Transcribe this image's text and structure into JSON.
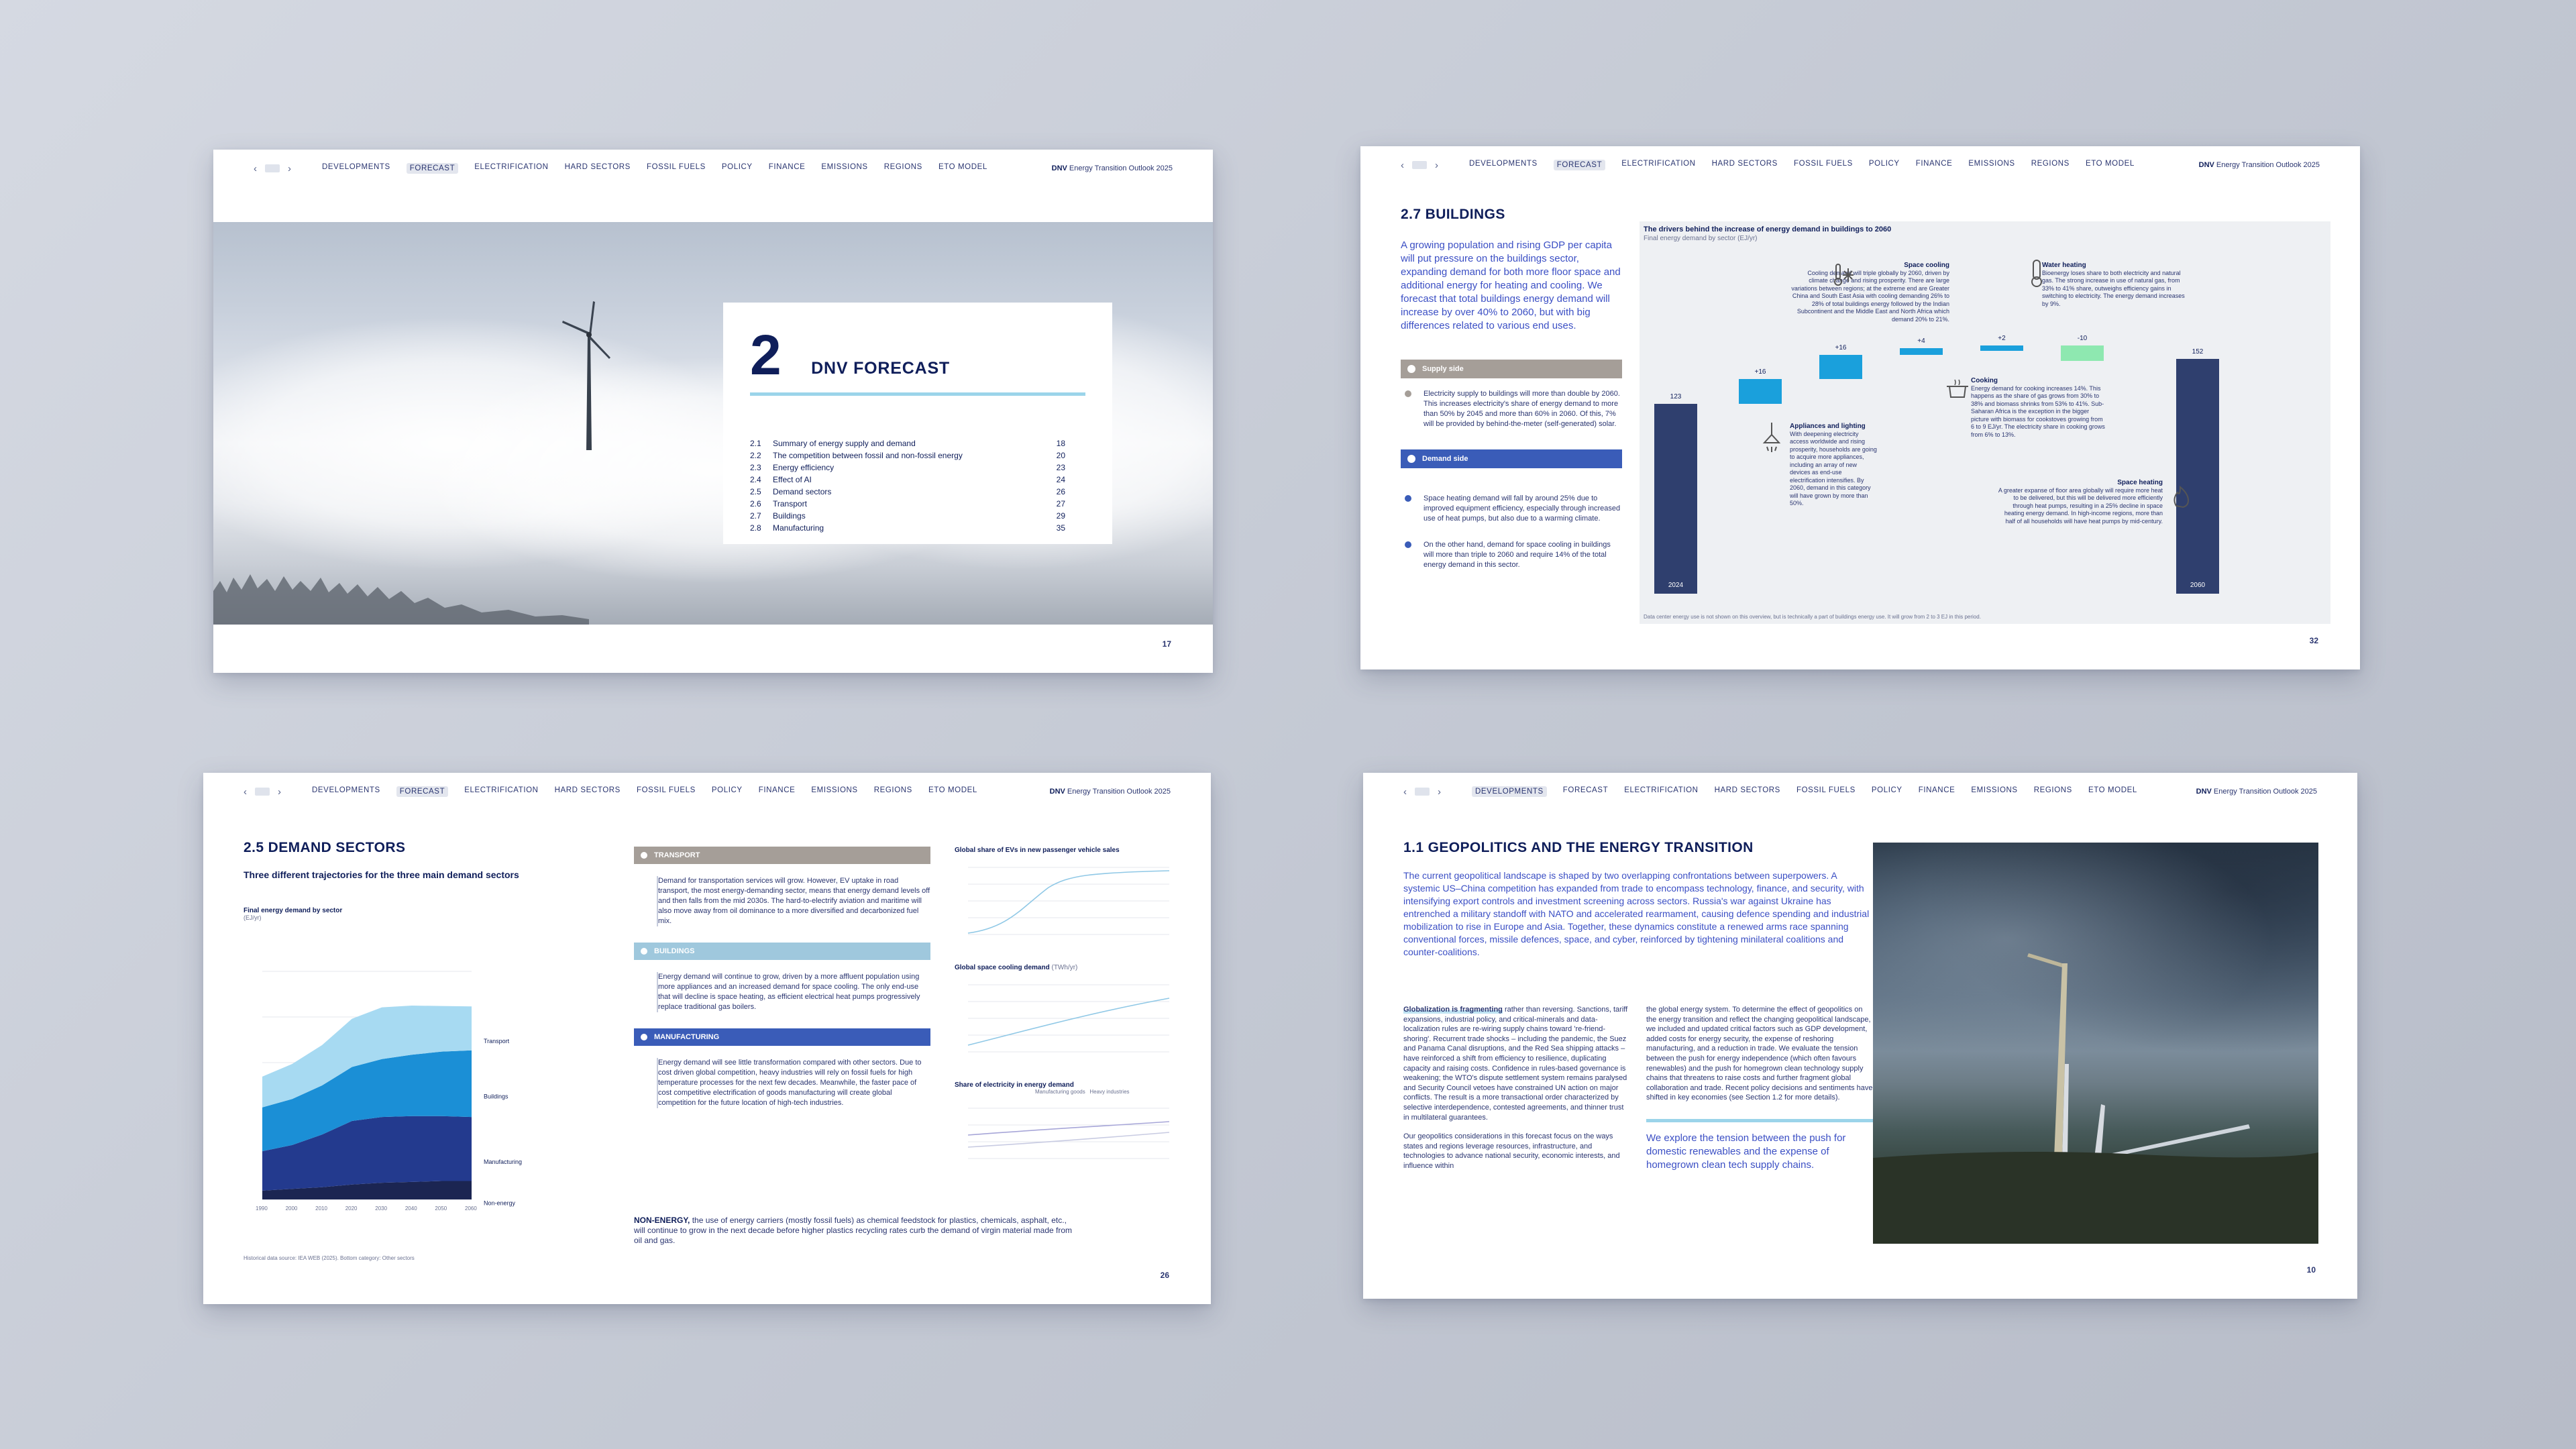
{
  "nav": {
    "items": [
      "DEVELOPMENTS",
      "FORECAST",
      "ELECTRIFICATION",
      "HARD SECTORS",
      "FOSSIL FUELS",
      "POLICY",
      "FINANCE",
      "EMISSIONS",
      "REGIONS",
      "ETO MODEL"
    ],
    "brand_bold": "DNV",
    "brand": "Energy Transition Outlook 2025"
  },
  "slide1": {
    "chapter_number": "2",
    "chapter_title": "DNV FORECAST",
    "toc": [
      {
        "n": "2.1",
        "t": "Summary of energy supply and demand",
        "p": "18"
      },
      {
        "n": "2.2",
        "t": "The competition between fossil and non-fossil energy",
        "p": "20"
      },
      {
        "n": "2.3",
        "t": "Energy efficiency",
        "p": "23"
      },
      {
        "n": "2.4",
        "t": "Effect of AI",
        "p": "24"
      },
      {
        "n": "2.5",
        "t": "Demand sectors",
        "p": "26"
      },
      {
        "n": "2.6",
        "t": "Transport",
        "p": "27"
      },
      {
        "n": "2.7",
        "t": "Buildings",
        "p": "29"
      },
      {
        "n": "2.8",
        "t": "Manufacturing",
        "p": "35"
      }
    ],
    "page": "17"
  },
  "slide2": {
    "heading": "2.7 BUILDINGS",
    "lead": "A growing population and rising GDP per capita will put pressure on the buildings sector, expanding demand for both more floor space and additional energy for heating and cooling. We forecast that total buildings energy demand will increase by over 40% to 2060, but with big differences related to various end uses.",
    "supply_label": "Supply side",
    "supply_text": "Electricity supply to buildings will more than double by 2060. This increases electricity's share of energy demand to more than 50% by 2045 and more than 60% in 2060. Of this, 7% will be provided by behind-the-meter (self-generated) solar.",
    "demand_label": "Demand side",
    "demand_text_1": "Space heating demand will fall by around 25% due to improved equipment efficiency, especially through increased use of heat pumps, but also due to a warming climate.",
    "demand_text_2": "On the other hand, demand for space cooling in buildings will more than triple to 2060 and require 14% of the total energy demand in this sector.",
    "chart_title": "The drivers behind the increase of energy demand in buildings to 2060",
    "chart_subtitle": "Final energy demand by sector (EJ/yr)",
    "notes": {
      "cooling_title": "Space cooling",
      "cooling_text": "Cooling demand will triple globally by 2060, driven by climate change and rising prosperity. There are large variations between regions; at the extreme end are Greater China and South East Asia with cooling demanding 26% to 28% of total buildings energy followed by the Indian Subcontinent and the Middle East and North Africa which demand 20% to 21%.",
      "water_title": "Water heating",
      "water_text": "Bioenergy loses share to both electricity and natural gas. The strong increase in use of natural gas, from 33% to 41% share, outweighs efficiency gains in switching to electricity. The energy demand increases by 9%.",
      "appliances_title": "Appliances and lighting",
      "appliances_text": "With deepening electricity access worldwide and rising prosperity, households are going to acquire more appliances, including an array of new devices as end-use electrification intensifies. By 2060, demand in this category will have grown by more than 50%.",
      "cooking_title": "Cooking",
      "cooking_text": "Energy demand for cooking increases 14%. This happens as the share of gas grows from 30% to 38% and biomass shrinks from 53% to 41%. Sub-Saharan Africa is the exception in the bigger picture with biomass for cookstoves growing from 6 to 9 EJ/yr. The electricity share in cooking grows from 6% to 13%.",
      "heating_title": "Space heating",
      "heating_text": "A greater expanse of floor area globally will require more heat to be delivered, but this will be delivered more efficiently through heat pumps, resulting in a 25% decline in space heating energy demand. In high-income regions, more than half of all households will have heat pumps by mid-century."
    },
    "footnote": "Data center energy use is not shown on this overview, but is technically a part of buildings energy use. It will grow from 2 to 3 EJ in this period.",
    "page": "32"
  },
  "slide3": {
    "heading": "2.5 DEMAND SECTORS",
    "subheading": "Three different trajectories for the three main demand sectors",
    "chart_title": "Final energy demand by sector",
    "chart_unit": "(EJ/yr)",
    "sector_labels": [
      "Transport",
      "Buildings",
      "Manufacturing",
      "Non-energy"
    ],
    "transport_label": "TRANSPORT",
    "transport_text": "Demand for transportation services will grow. However, EV uptake in road transport, the most energy-demanding sector, means that energy demand levels off and then falls from the mid 2030s. The hard-to-electrify aviation and maritime will also move away from oil dominance to a more diversified and decarbonized fuel mix.",
    "buildings_label": "BUILDINGS",
    "buildings_text": "Energy demand will continue to grow, driven by a more affluent population using more appliances and an increased demand for space cooling. The only end-use that will decline is space heating, as efficient electrical heat pumps progressively replace traditional gas boilers.",
    "manufacturing_label": "MANUFACTURING",
    "manufacturing_text": "Energy demand will see little transformation compared with other sectors. Due to cost driven global competition, heavy industries will rely on fossil fuels for high temperature processes for the next few decades. Meanwhile, the faster pace of cost competitive electrification of goods manufacturing will create global competition for the future location of high-tech industries.",
    "chart2_title": "Global share of EVs in new passenger vehicle sales",
    "chart3_title": "Global space cooling demand",
    "chart3_unit": "(TWh/yr)",
    "chart4_title": "Share of electricity in energy demand",
    "chart4_legend": [
      "Manufacturing goods",
      "Heavy industries"
    ],
    "non_energy_bold": "NON-ENERGY,",
    "non_energy_text": "the use of energy carriers (mostly fossil fuels) as chemical feedstock for plastics, chemicals, asphalt, etc., will continue to grow in the next decade before higher plastics recycling rates curb the demand of virgin material made from oil and gas.",
    "source": "Historical data source: IEA WEB (2025). Bottom category: Other sectors",
    "page": "26"
  },
  "slide4": {
    "heading": "1.1 GEOPOLITICS AND THE ENERGY TRANSITION",
    "lead": "The current geopolitical landscape is shaped by two overlapping confrontations between superpowers. A systemic US–China competition has expanded from trade to encompass technology, finance, and security, with intensifying export controls and investment screening across sectors. Russia's war against Ukraine has entrenched a military standoff with NATO and accelerated rearmament, causing defence spending and industrial mobilization to rise in Europe and Asia. Together, these dynamics constitute a renewed arms race spanning conventional forces, missile defences, space, and cyber, reinforced by tightening minilateral coalitions and counter-coalitions.",
    "col1_bold": "Globalization is fragmenting",
    "col1": "rather than reversing. Sanctions, tariff expansions, industrial policy, and critical-minerals and data-localization rules are re-wiring supply chains toward 're-friend-shoring'. Recurrent trade shocks – including the pandemic, the Suez and Panama Canal disruptions, and the Red Sea shipping attacks – have reinforced a shift from efficiency to resilience, duplicating capacity and raising costs. Confidence in rules-based governance is weakening; the WTO's dispute settlement system remains paralysed and Security Council vetoes have constrained UN action on major conflicts. The result is a more transactional order characterized by selective interdependence, contested agreements, and thinner trust in multilateral guarantees.",
    "col1_b": "Our geopolitics considerations in this forecast focus on the ways states and regions leverage resources, infrastructure, and technologies to advance national security, economic interests, and influence within",
    "col2": "the global energy system. To determine the effect of geopolitics on the energy transition and reflect the changing geopolitical landscape, we included and updated critical factors such as GDP development, added costs for energy security, the expense of reshoring manufacturing, and a reduction in trade. We evaluate the tension between the push for energy independence (which often favours renewables) and the push for homegrown clean technology supply chains that threatens to raise costs and further fragment global collaboration and trade. Recent policy decisions and sentiments have shifted in key economies (see Section 1.2 for more details).",
    "quote": "We explore the tension between the push for domestic renewables and the expense of homegrown clean tech supply chains.",
    "page": "10"
  },
  "chart_data": [
    {
      "type": "bar",
      "title": "The drivers behind the increase of energy demand in buildings to 2060",
      "subtitle": "Final energy demand by sector (EJ/yr)",
      "categories": [
        "2024",
        "Appliances and lighting",
        "Space cooling",
        "Cooking",
        "Water heating",
        "Space heating",
        "2060"
      ],
      "values": [
        123,
        16,
        16,
        4,
        2,
        -10,
        152
      ],
      "labels": [
        "123",
        "+16",
        "+16",
        "+4",
        "+2",
        "-10",
        "152"
      ]
    },
    {
      "type": "area",
      "title": "Final energy demand by sector",
      "ylabel": "(EJ/yr)",
      "x": [
        "1990",
        "2000",
        "2010",
        "2020",
        "2030",
        "2040",
        "2050",
        "2060"
      ],
      "series": [
        {
          "name": "Non-energy",
          "values": [
            20,
            24,
            28,
            34,
            38,
            40,
            42,
            42
          ]
        },
        {
          "name": "Manufacturing",
          "values": [
            90,
            100,
            120,
            145,
            150,
            150,
            148,
            146
          ]
        },
        {
          "name": "Buildings",
          "values": [
            100,
            105,
            112,
            123,
            132,
            140,
            147,
            152
          ]
        },
        {
          "name": "Transport",
          "values": [
            70,
            80,
            92,
            110,
            118,
            112,
            104,
            100
          ]
        }
      ]
    }
  ],
  "colors": {
    "navy": "#0f1e5a",
    "blue": "#3b4fc4",
    "light_blue": "#9bd4ea",
    "cyan": "#1aa0dc",
    "green": "#8ee8b0",
    "dark_bar": "#2f3f6e",
    "taupe": "#a59e98",
    "demand_blue": "#3a5cb8"
  },
  "icons": [
    "chevron-left-icon",
    "menu-icon",
    "chevron-right-icon",
    "snowflake-thermometer-icon",
    "thermometer-icon",
    "lamp-icon",
    "cooking-pot-icon",
    "heating-icon",
    "car-icon",
    "house-icon",
    "factory-icon",
    "flask-icon"
  ]
}
